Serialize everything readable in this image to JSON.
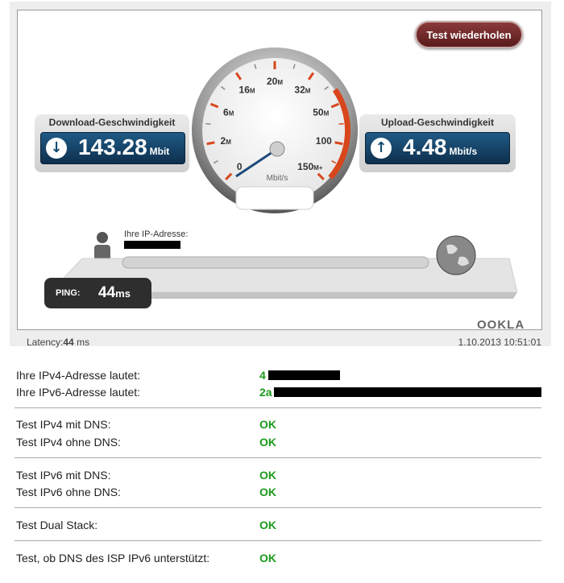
{
  "speedtest": {
    "retest_label": "Test wiederholen",
    "download": {
      "label": "Download-Geschwindigkeit",
      "value": "143.28",
      "unit": "Mbit"
    },
    "upload": {
      "label": "Upload-Geschwindigkeit",
      "value": "4.48",
      "unit": "Mbit/s"
    },
    "gauge": {
      "ticks": [
        {
          "num": "0",
          "unit": ""
        },
        {
          "num": "2",
          "unit": "M"
        },
        {
          "num": "6",
          "unit": "M"
        },
        {
          "num": "16",
          "unit": "M"
        },
        {
          "num": "20",
          "unit": "M"
        },
        {
          "num": "32",
          "unit": "M"
        },
        {
          "num": "50",
          "unit": "M"
        },
        {
          "num": "100",
          "unit": ""
        },
        {
          "num": "150",
          "unit": "M+"
        }
      ],
      "unit_label": "Mbit/s",
      "needle_value": "2"
    },
    "ip_label": "Ihre IP-Adresse:",
    "ping": {
      "label": "PING:",
      "value": "44",
      "unit": "ms"
    },
    "brand": "OOKLA",
    "latency_label": "Latency:",
    "latency_value": "44",
    "latency_unit": " ms",
    "timestamp": "1.10.2013 10:51:01"
  },
  "results": [
    {
      "label": "Ihre IPv4-Adresse lautet:",
      "value": "4"
    },
    {
      "label": "Ihre IPv6-Adresse lautet:",
      "value": "2a"
    },
    {
      "label": "Test IPv4 mit DNS:",
      "value": "OK"
    },
    {
      "label": "Test IPv4 ohne DNS:",
      "value": "OK"
    },
    {
      "label": "Test IPv6 mit DNS:",
      "value": "OK"
    },
    {
      "label": "Test IPv6 ohne DNS:",
      "value": "OK"
    },
    {
      "label": "Test Dual Stack:",
      "value": "OK"
    },
    {
      "label": "Test, ob DNS des ISP IPv6 unterstützt:",
      "value": "OK"
    }
  ],
  "colors": {
    "ok": "#1a9a1a",
    "accent": "#124a70",
    "ping_bg": "#2e2e2e"
  }
}
